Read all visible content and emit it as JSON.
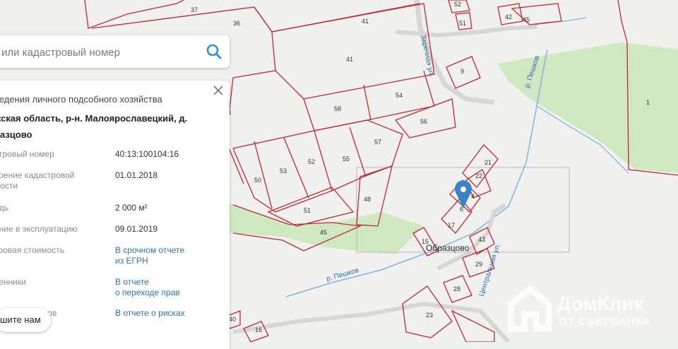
{
  "search": {
    "placeholder": "или кадастровый номер",
    "icon": "search-icon"
  },
  "panel": {
    "title": "ведения личного подсобного хозяйства",
    "address_line1": "жская область, р-н. Малоярославецкий, д.",
    "address_line2": "разцово",
    "rows": [
      {
        "label": "стровый номер",
        "value": "40:13:100104:16"
      },
      {
        "label_line1": "воение кадастровой",
        "label_line2": "мости",
        "value": "01.01.2018"
      },
      {
        "label": "адь",
        "value": "2 000 м²"
      },
      {
        "label": "ение в эксплуатацию",
        "value": "09.01.2019"
      },
      {
        "label": "тровая стоимость",
        "value_line1": "В срочном отчете",
        "value_line2": "из ЕГРН"
      },
      {
        "label": "венники",
        "value_line1": "В отчете",
        "value_line2": "о переходе прав"
      },
      {
        "label": "ков",
        "value": "В отчете о рисках"
      }
    ]
  },
  "feedback": {
    "label": "шите нам"
  },
  "map": {
    "parcels": [
      "37",
      "36",
      "41",
      "41",
      "54",
      "58",
      "56",
      "57",
      "55",
      "50",
      "53",
      "52",
      "51",
      "48",
      "45",
      "8",
      "9",
      "21",
      "22",
      "4",
      "6",
      "17",
      "43",
      "15",
      "29",
      "28",
      "23",
      "16",
      "40",
      "42",
      "45",
      "52",
      "51",
      "1"
    ],
    "streets": [
      "Заречная ул.",
      "р. Пешков",
      "р. Пешков",
      "Центральная ул."
    ],
    "village": "Образцово"
  },
  "logo": {
    "name": "ДомКлик",
    "subtitle": "ОТ СБЕРБАНКА"
  },
  "colors": {
    "parcel_line": "#c0282d",
    "forest": "#cfe8c2",
    "water": "#6aa8d8",
    "accent": "#2f6fb8",
    "pin": "#3a82c8"
  }
}
